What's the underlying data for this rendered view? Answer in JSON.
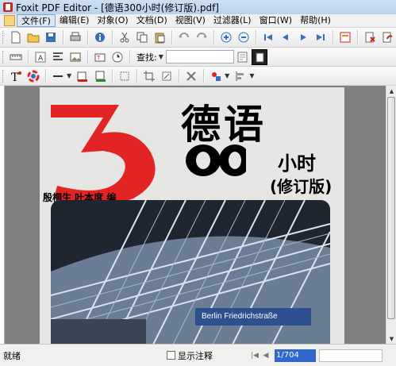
{
  "window": {
    "title": "Foxit PDF Editor - [德语300小时(修订版).pdf]"
  },
  "menu": [
    "文件(F)",
    "编辑(E)",
    "对象(O)",
    "文档(D)",
    "视图(V)",
    "过滤器(L)",
    "窗口(W)",
    "帮助(H)"
  ],
  "toolbar": {
    "search_label": "查找:",
    "search_value": ""
  },
  "cover": {
    "title": "德语",
    "subtitle": "小时",
    "edition": "(修订版)",
    "authors": "殷桐生  叶本度  编",
    "sign_text": "Berlin Friedrichstraße"
  },
  "status": {
    "text": "就绪",
    "checkbox_label": "显示注释",
    "page_value": "1/704"
  },
  "colors": {
    "accent_red": "#e32424",
    "sign_blue": "#2e4f90",
    "titlebar": "#c4d8ee"
  }
}
